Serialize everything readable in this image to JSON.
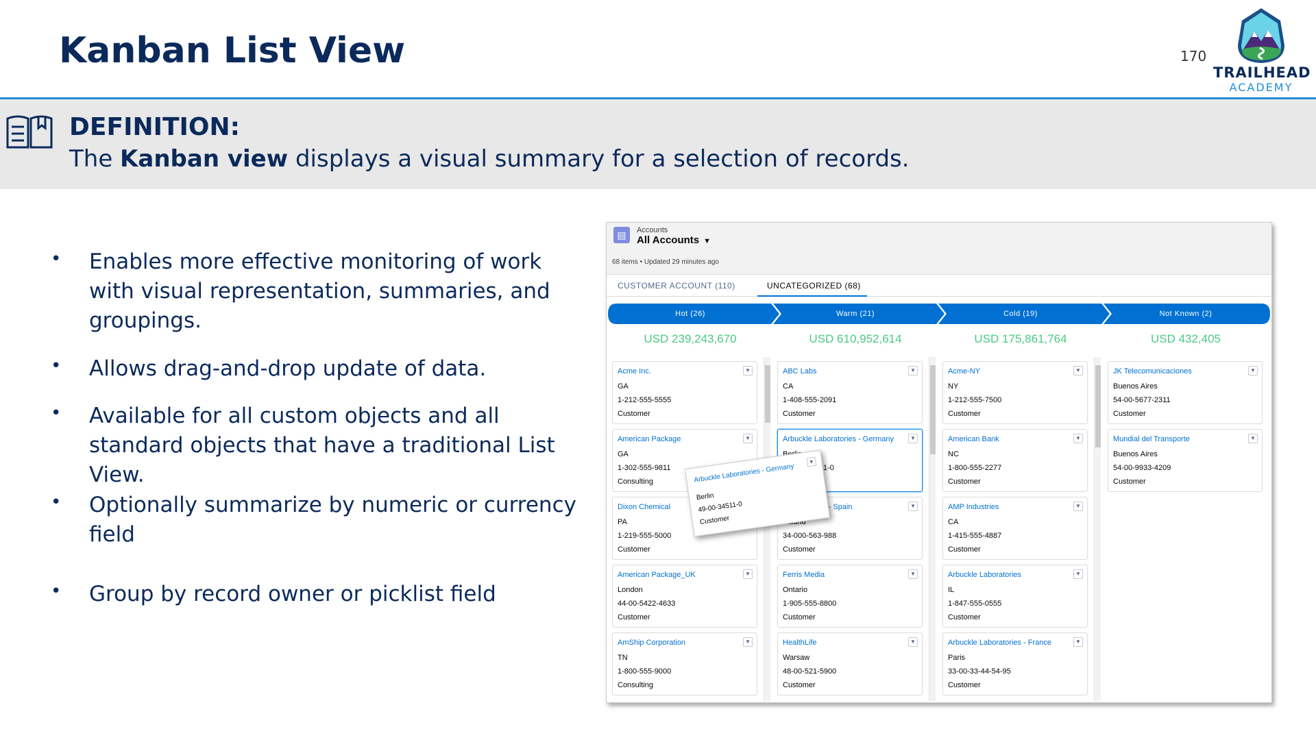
{
  "slide": {
    "title": "Kanban List View",
    "page_number": "170",
    "logo_line1": "TRAILHEAD",
    "logo_line2": "ACADEMY"
  },
  "definition": {
    "heading": "DEFINITION:",
    "text_before": "The ",
    "text_bold": "Kanban view",
    "text_after": " displays a visual summary for a selection of records."
  },
  "bullets": [
    "Enables more effective monitoring of work with visual representation, summaries, and groupings.",
    "Allows drag-and-drop update of data.",
    "Available for all custom objects and all standard objects that have a traditional List View.",
    "Optionally summarize by numeric or currency field",
    "Group by record owner or picklist field"
  ],
  "kanban": {
    "object_label": "Accounts",
    "view_name": "All Accounts",
    "meta": "68 items • Updated 29 minutes ago",
    "tabs": [
      {
        "label": "CUSTOMER ACCOUNT (110)",
        "active": false
      },
      {
        "label": "UNCATEGORIZED (68)",
        "active": true
      }
    ],
    "stage_color": "#0070d2",
    "total_color": "#4bca81",
    "columns": [
      {
        "stage": "Hot   (26)",
        "total": "USD 239,243,670",
        "cards": [
          {
            "name": "Acme Inc.",
            "l1": "GA",
            "l2": "1-212-555-5555",
            "l3": "Customer"
          },
          {
            "name": "American Package",
            "l1": "GA",
            "l2": "1-302-555-9811",
            "l3": "Consulting"
          },
          {
            "name": "Dixon Chemical",
            "l1": "PA",
            "l2": "1-219-555-5000",
            "l3": "Customer"
          },
          {
            "name": "American Package_UK",
            "l1": "London",
            "l2": "44-00-5422-4633",
            "l3": "Customer"
          },
          {
            "name": "AmShip Corporation",
            "l1": "TN",
            "l2": "1-800-555-9000",
            "l3": "Consulting"
          }
        ]
      },
      {
        "stage": "Warm   (21)",
        "total": "USD 610,952,614",
        "cards": [
          {
            "name": "ABC Labs",
            "l1": "CA",
            "l2": "1-408-555-2091",
            "l3": "Customer"
          },
          {
            "name": "Arbuckle Laboratories - Germany",
            "l1": "Berlin",
            "l2": "1-0",
            "l3": ""
          },
          {
            "name": "al - Spain",
            "l1": "Madrid",
            "l2": "34-000-563-988",
            "l3": "Customer"
          },
          {
            "name": "Ferris Media",
            "l1": "Ontario",
            "l2": "1-905-555-8800",
            "l3": "Customer"
          },
          {
            "name": "HealthLife",
            "l1": "Warsaw",
            "l2": "48-00-521-5900",
            "l3": "Customer"
          }
        ]
      },
      {
        "stage": "Cold   (19)",
        "total": "USD 175,861,764",
        "cards": [
          {
            "name": "Acme-NY",
            "l1": "NY",
            "l2": "1-212-555-7500",
            "l3": "Customer"
          },
          {
            "name": "American Bank",
            "l1": "NC",
            "l2": "1-800-555-2277",
            "l3": "Customer"
          },
          {
            "name": "AMP Industries",
            "l1": "CA",
            "l2": "1-415-555-4887",
            "l3": "Customer"
          },
          {
            "name": "Arbuckle Laboratories",
            "l1": "IL",
            "l2": "1-847-555-0555",
            "l3": "Customer"
          },
          {
            "name": "Arbuckle Laboratories - France",
            "l1": "Paris",
            "l2": "33-00-33-44-54-95",
            "l3": "Customer"
          }
        ]
      },
      {
        "stage": "Not Known   (2)",
        "total": "USD 432,405",
        "cards": [
          {
            "name": "JK Telecomunicaciones",
            "l1": "Buenos Aires",
            "l2": "54-00-5677-2311",
            "l3": "Customer"
          },
          {
            "name": "Mundial del Transporte",
            "l1": "Buenos Aires",
            "l2": "54-00-9933-4209",
            "l3": "Customer"
          }
        ]
      }
    ],
    "drag_card": {
      "name": "Arbuckle Laboratories - Germany",
      "l1": "Berlin",
      "l2": "49-00-34511-0",
      "l3": "Customer"
    }
  }
}
